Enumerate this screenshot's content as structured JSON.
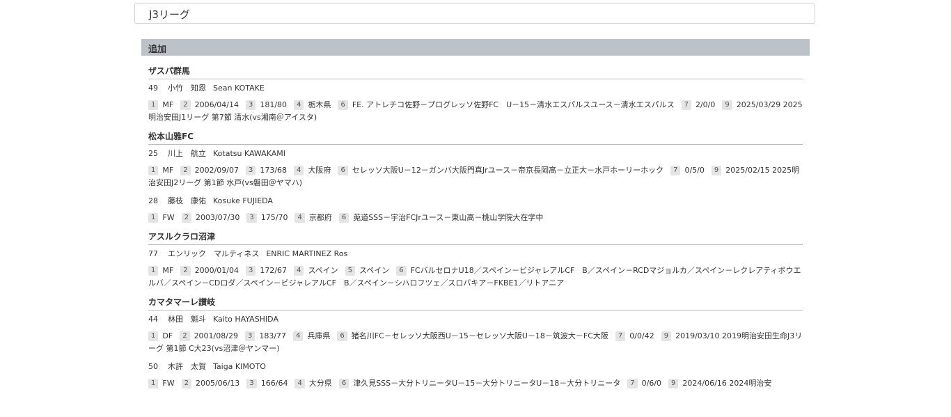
{
  "league": {
    "title": "J3リーグ"
  },
  "section": {
    "title": "追加"
  },
  "teams": [
    {
      "name": "ザスパ群馬",
      "players": [
        {
          "number": "49",
          "name_ja": "小竹　知恩",
          "name_en": "Sean KOTAKE",
          "fields": [
            {
              "tag": "1",
              "value": "MF"
            },
            {
              "tag": "2",
              "value": "2006/04/14"
            },
            {
              "tag": "3",
              "value": "181/80"
            },
            {
              "tag": "4",
              "value": "栃木県"
            },
            {
              "tag": "6",
              "value": "FE. アトレチコ佐野－プログレッソ佐野FC　U－15－清水エスパルスユース－清水エスパルス"
            },
            {
              "tag": "7",
              "value": "2/0/0"
            },
            {
              "tag": "9",
              "value": "2025/03/29 2025明治安田J1リーグ 第7節 清水(vs湘南＠アイスタ)"
            }
          ]
        }
      ]
    },
    {
      "name": "松本山雅FC",
      "players": [
        {
          "number": "25",
          "name_ja": "川上　航立",
          "name_en": "Kotatsu KAWAKAMI",
          "fields": [
            {
              "tag": "1",
              "value": "MF"
            },
            {
              "tag": "2",
              "value": "2002/09/07"
            },
            {
              "tag": "3",
              "value": "173/68"
            },
            {
              "tag": "4",
              "value": "大阪府"
            },
            {
              "tag": "6",
              "value": "セレッソ大阪U－12－ガンバ大阪門真Jrユース－帝京長岡高－立正大－水戸ホーリーホック"
            },
            {
              "tag": "7",
              "value": "0/5/0"
            },
            {
              "tag": "9",
              "value": "2025/02/15 2025明治安田J2リーグ 第1節 水戸(vs磐田＠ヤマハ)"
            }
          ]
        },
        {
          "number": "28",
          "name_ja": "藤枝　康佑",
          "name_en": "Kosuke FUJIEDA",
          "fields": [
            {
              "tag": "1",
              "value": "FW"
            },
            {
              "tag": "2",
              "value": "2003/07/30"
            },
            {
              "tag": "3",
              "value": "175/70"
            },
            {
              "tag": "4",
              "value": "京都府"
            },
            {
              "tag": "6",
              "value": "莵道SSS－宇治FCJrユース－東山高－桃山学院大在学中"
            }
          ]
        }
      ]
    },
    {
      "name": "アスルクラロ沼津",
      "players": [
        {
          "number": "77",
          "name_ja": "エンリック　マルティネス",
          "name_en": "ENRIC MARTINEZ Ros",
          "fields": [
            {
              "tag": "1",
              "value": "MF"
            },
            {
              "tag": "2",
              "value": "2000/01/04"
            },
            {
              "tag": "3",
              "value": "172/67"
            },
            {
              "tag": "4",
              "value": "スペイン"
            },
            {
              "tag": "5",
              "value": "スペイン"
            },
            {
              "tag": "6",
              "value": "FCバルセロナU18／スペイン－ビジャレアルCF　B／スペイン－RCDマジョルカ／スペイン－レクレアティボウエルバ／スペイン－CDロダ／スペイン－ビジャレアルCF　B／スペイン－シハロフツェ／スロバキア－FKBE1／リトアニア"
            }
          ]
        }
      ]
    },
    {
      "name": "カマタマーレ讃岐",
      "players": [
        {
          "number": "44",
          "name_ja": "林田　魁斗",
          "name_en": "Kaito HAYASHIDA",
          "fields": [
            {
              "tag": "1",
              "value": "DF"
            },
            {
              "tag": "2",
              "value": "2001/08/29"
            },
            {
              "tag": "3",
              "value": "183/77"
            },
            {
              "tag": "4",
              "value": "兵庫県"
            },
            {
              "tag": "6",
              "value": "猪名川FC－セレッソ大阪西U－15－セレッソ大阪U－18－筑波大－FC大阪"
            },
            {
              "tag": "7",
              "value": "0/0/42"
            },
            {
              "tag": "9",
              "value": "2019/03/10 2019明治安田生命J3リーグ 第1節 C大23(vs沼津＠ヤンマー)"
            }
          ]
        },
        {
          "number": "50",
          "name_ja": "木許　太賀",
          "name_en": "Taiga KIMOTO",
          "fields": [
            {
              "tag": "1",
              "value": "FW"
            },
            {
              "tag": "2",
              "value": "2005/06/13"
            },
            {
              "tag": "3",
              "value": "166/64"
            },
            {
              "tag": "4",
              "value": "大分県"
            },
            {
              "tag": "6",
              "value": "津久見SSS－大分トリニータU－15－大分トリニータU－18－大分トリニータ"
            },
            {
              "tag": "7",
              "value": "0/6/0"
            },
            {
              "tag": "9",
              "value": "2024/06/16 2024明治安"
            }
          ]
        }
      ]
    }
  ]
}
